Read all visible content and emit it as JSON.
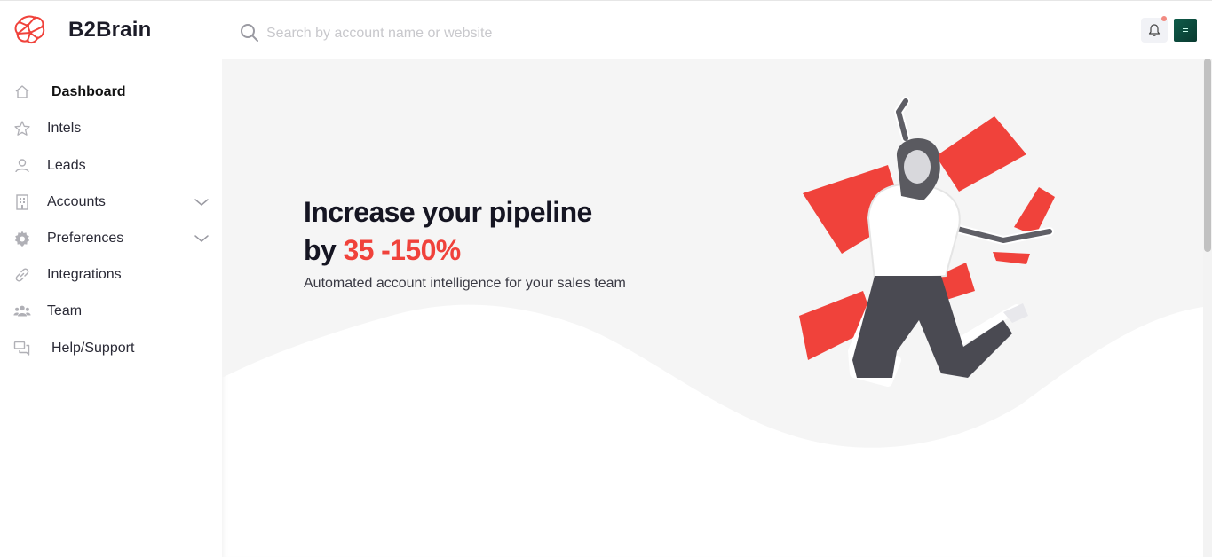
{
  "brand": {
    "name": "B2Brain"
  },
  "search": {
    "placeholder": "Search by account name or website"
  },
  "header": {
    "notification_icon": "bell-icon",
    "has_unread": true
  },
  "sidebar": {
    "items": [
      {
        "label": "Dashboard",
        "icon": "home-icon",
        "active": true
      },
      {
        "label": "Intels",
        "icon": "star-icon"
      },
      {
        "label": "Leads",
        "icon": "user-icon"
      },
      {
        "label": "Accounts",
        "icon": "building-icon",
        "expandable": true
      },
      {
        "label": "Preferences",
        "icon": "gear-icon",
        "expandable": true
      },
      {
        "label": "Integrations",
        "icon": "link-icon"
      },
      {
        "label": "Team",
        "icon": "team-icon"
      },
      {
        "label": "Help/Support",
        "icon": "chat-icon"
      }
    ]
  },
  "hero": {
    "line1": "Increase your pipeline",
    "line2_prefix": "by ",
    "line2_accent": "35 -150%",
    "subtitle": "Automated account intelligence for your sales team"
  },
  "colors": {
    "accent": "#f0423b",
    "text": "#151522",
    "hero_bg": "#f5f5f5"
  }
}
